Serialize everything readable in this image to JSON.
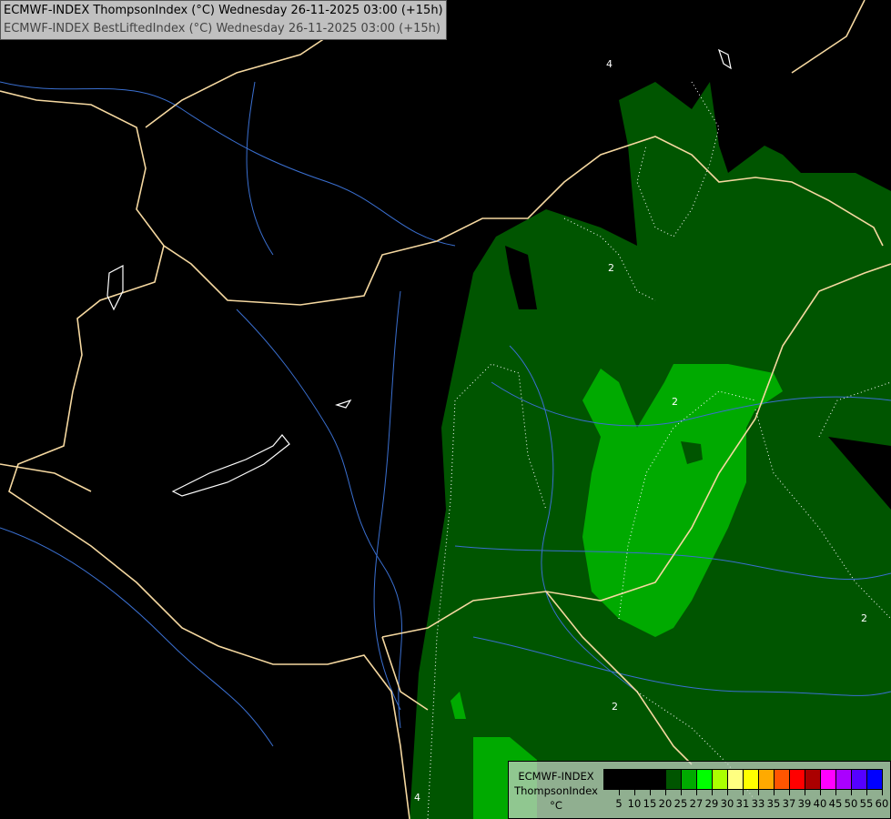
{
  "titles": [
    "ECMWF-INDEX ThompsonIndex (°C) Wednesday 26-11-2025 03:00 (+15h)",
    "ECMWF-INDEX BestLiftedIndex (°C) Wednesday 26-11-2025 03:00 (+15h)"
  ],
  "legend": {
    "line1": "ECMWF-INDEX",
    "line2": "ThompsonIndex",
    "unit": "°C",
    "colors": [
      "#000000",
      "#000000",
      "#000000",
      "#000000",
      "#005500",
      "#00aa00",
      "#00ff00",
      "#aaff00",
      "#ffff80",
      "#ffff00",
      "#ffaa00",
      "#ff5500",
      "#ff0000",
      "#aa0000",
      "#ff00ff",
      "#aa00ff",
      "#5500ff",
      "#0000ff"
    ],
    "ticks": [
      "5",
      "10",
      "15",
      "20",
      "25",
      "27",
      "29",
      "30",
      "31",
      "33",
      "35",
      "37",
      "39",
      "40",
      "45",
      "50",
      "55",
      "60"
    ]
  },
  "contour_labels": [
    "2",
    "2",
    "2",
    "4",
    "2",
    "4"
  ],
  "colors": {
    "border": "#f5d8a0",
    "river": "#3a6fd0",
    "lake": "#ffffff",
    "bli_contour": "#ffffff"
  }
}
